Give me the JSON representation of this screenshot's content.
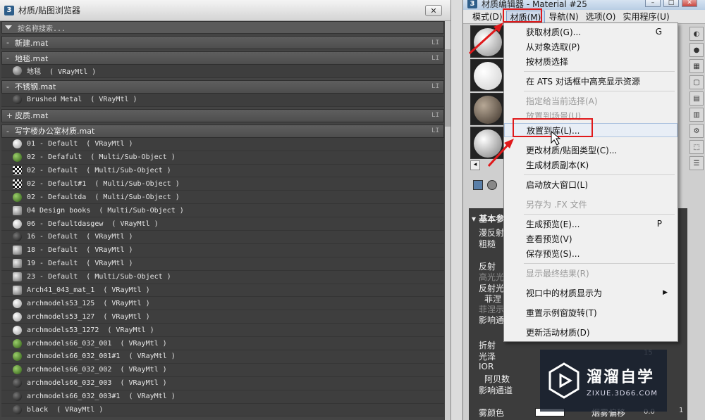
{
  "browser": {
    "title": "材质/贴图浏览器",
    "search_placeholder": "按名称搜索...",
    "groups": [
      {
        "sign": "-",
        "name": "新建.mat",
        "tag": "LI",
        "items": []
      },
      {
        "sign": "-",
        "name": "地毯.mat",
        "tag": "LI",
        "items": [
          {
            "name": "地毯  ( VRayMtl )",
            "swatch": "gray"
          }
        ]
      },
      {
        "sign": "-",
        "name": "不锈钢.mat",
        "tag": "LI",
        "items": [
          {
            "name": "Brushed Metal  ( VRayMtl )",
            "swatch": "dark"
          }
        ]
      },
      {
        "sign": "+",
        "name": "皮质.mat",
        "tag": "LI",
        "items": []
      },
      {
        "sign": "-",
        "name": "写字楼办公室材质.mat",
        "tag": "LI",
        "items": [
          {
            "name": "01 - Default  ( VRayMtl )",
            "swatch": "white"
          },
          {
            "name": "02 - Defafult  ( Multi/Sub-Object )",
            "swatch": "green"
          },
          {
            "name": "02 - Default  ( Multi/Sub-Object )",
            "swatch": "checker"
          },
          {
            "name": "02 - Default#1  ( Multi/Sub-Object )",
            "swatch": "checker"
          },
          {
            "name": "02 - Defaultda  ( Multi/Sub-Object )",
            "swatch": "green"
          },
          {
            "name": "04 Design books  ( Multi/Sub-Object )",
            "swatch": "pattern"
          },
          {
            "name": "06 - Defaultdasgew  ( VRayMtl )",
            "swatch": "white"
          },
          {
            "name": "16 - Default  ( VRayMtl )",
            "swatch": "dark"
          },
          {
            "name": "18 - Default  ( VRayMtl )",
            "swatch": "pattern"
          },
          {
            "name": "19 - Default  ( VRayMtl )",
            "swatch": "pattern"
          },
          {
            "name": "23 - Default  ( Multi/Sub-Object )",
            "swatch": "pattern"
          },
          {
            "name": "Arch41_043_mat_1  ( VRayMtl )",
            "swatch": "pattern"
          },
          {
            "name": "archmodels53_125  ( VRayMtl )",
            "swatch": "white"
          },
          {
            "name": "archmodels53_127  ( VRayMtl )",
            "swatch": "white"
          },
          {
            "name": "archmodels53_1272  ( VRayMtl )",
            "swatch": "white"
          },
          {
            "name": "archmodels66_032_001  ( VRayMtl )",
            "swatch": "green"
          },
          {
            "name": "archmodels66_032_001#1  ( VRayMtl )",
            "swatch": "green"
          },
          {
            "name": "archmodels66_032_002  ( VRayMtl )",
            "swatch": "green"
          },
          {
            "name": "archmodels66_032_003  ( VRayMtl )",
            "swatch": "dark"
          },
          {
            "name": "archmodels66_032_003#1  ( VRayMtl )",
            "swatch": "dark"
          },
          {
            "name": "black  ( VRayMtl )",
            "swatch": "dark"
          }
        ]
      }
    ]
  },
  "editor": {
    "title": "材质编辑器 - Material #25",
    "menus": [
      "模式(D)",
      "材质(M)",
      "导航(N)",
      "选项(O)",
      "实用程序(U)"
    ],
    "params": {
      "rollout": "基本参",
      "labels": [
        "漫反射",
        "粗糙",
        "反射",
        "高光光",
        "反射光",
        "菲涅",
        "菲涅示",
        "影响通",
        "折射",
        "光泽",
        "IOR",
        "阿贝数",
        "影响通道",
        "雾颜色",
        "烟雾偏移"
      ],
      "values": [
        "15",
        "0.0",
        "1"
      ]
    }
  },
  "dropdown": {
    "items": [
      {
        "label": "获取材质(G)...",
        "shortcut": "G",
        "disabled": false
      },
      {
        "label": "从对象选取(P)",
        "shortcut": "",
        "disabled": false
      },
      {
        "label": "按材质选择",
        "shortcut": "",
        "disabled": false
      },
      {
        "label": "在 ATS 对话框中高亮显示资源",
        "shortcut": "",
        "disabled": false
      },
      {
        "label": "指定给当前选择(A)",
        "shortcut": "",
        "disabled": true
      },
      {
        "label": "放置到场景(U)",
        "shortcut": "",
        "disabled": true
      },
      {
        "label": "放置到库(L)...",
        "shortcut": "",
        "disabled": false
      },
      {
        "label": "更改材质/贴图类型(C)...",
        "shortcut": "",
        "disabled": false
      },
      {
        "label": "生成材质副本(K)",
        "shortcut": "",
        "disabled": false
      },
      {
        "label": "启动放大窗口(L)",
        "shortcut": "",
        "disabled": false
      },
      {
        "label": "另存为 .FX 文件",
        "shortcut": "",
        "disabled": true
      },
      {
        "label": "生成预览(E)...",
        "shortcut": "P",
        "disabled": false
      },
      {
        "label": "查看预览(V)",
        "shortcut": "",
        "disabled": false
      },
      {
        "label": "保存预览(S)...",
        "shortcut": "",
        "disabled": false
      },
      {
        "label": "显示最终结果(R)",
        "shortcut": "",
        "disabled": true
      },
      {
        "label": "视口中的材质显示为",
        "shortcut": "",
        "disabled": false,
        "submenu": true
      },
      {
        "label": "重置示例窗旋转(T)",
        "shortcut": "",
        "disabled": false
      },
      {
        "label": "更新活动材质(D)",
        "shortcut": "",
        "disabled": false
      }
    ]
  },
  "watermark": {
    "title": "溜溜自学",
    "subtitle": "ZIXUE.3D66.COM"
  },
  "colors": {
    "highlight_box": "#e0191b",
    "panel_dark": "#444444"
  }
}
